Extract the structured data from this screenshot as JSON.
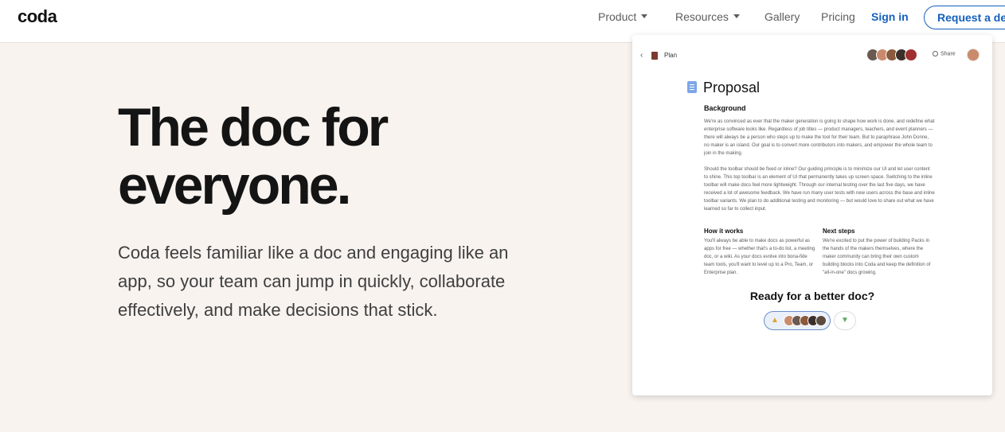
{
  "nav": {
    "logo": "coda",
    "items": [
      {
        "label": "Product",
        "dropdown": true
      },
      {
        "label": "Resources",
        "dropdown": true
      },
      {
        "label": "Gallery",
        "dropdown": false
      },
      {
        "label": "Pricing",
        "dropdown": false
      }
    ],
    "sign_in": "Sign in",
    "request_demo": "Request a demo"
  },
  "hero": {
    "title_line1": "The doc for",
    "title_line2": "everyone.",
    "subtitle": "Coda feels familiar like a doc and engaging like an app, so your team can jump in quickly, collaborate effectively, and make decisions that stick."
  },
  "doc": {
    "back_icon": "chevron-left-icon",
    "breadcrumb": "Plan",
    "share_label": "Share",
    "title": "Proposal",
    "background_heading": "Background",
    "background_p1": "We're as convinced as ever that the maker generation is going to shape how work is done, and redefine what enterprise software looks like. Regardless of job titles — product managers, teachers, and event planners — there will always be a person who steps up to make the tool for their team. But to paraphrase John Donne, no maker is an island. Our goal is to convert more contributors into makers, and empower the whole team to join in the making.",
    "background_p2": "Should the toolbar should be fixed or inline? Our guiding principle is to minimize our UI and let user content to shine. This top toolbar is an element of UI that permanently takes up screen space. Switching to the inline toolbar will make docs feel more lightweight. Through our internal testing over the last five days, we have received a lot of awesome feedback. We have run many user tests with new users across the base and inline toolbar variants. We plan to do additional testing and monitoring — but would love to share out what we have learned so far to collect input.",
    "how_heading": "How it works",
    "how_text": "You'll always be able to make docs as powerful as apps for free — whether that's a to-do list, a meeting doc, or a wiki. As your docs evolve into bona-fide team tools, you'll want to level up to a Pro, Team, or Enterprise plan.",
    "next_heading": "Next steps",
    "next_text": "We're excited to put the power of building Packs in the hands of the makers themselves, where the maker community can bring their own custom building blocks into Coda and keep the definition of \"all-in-one\" docs growing.",
    "cta": "Ready for a better doc?"
  },
  "colors": {
    "accent": "#1560bd",
    "background": "#f8f3ef"
  }
}
